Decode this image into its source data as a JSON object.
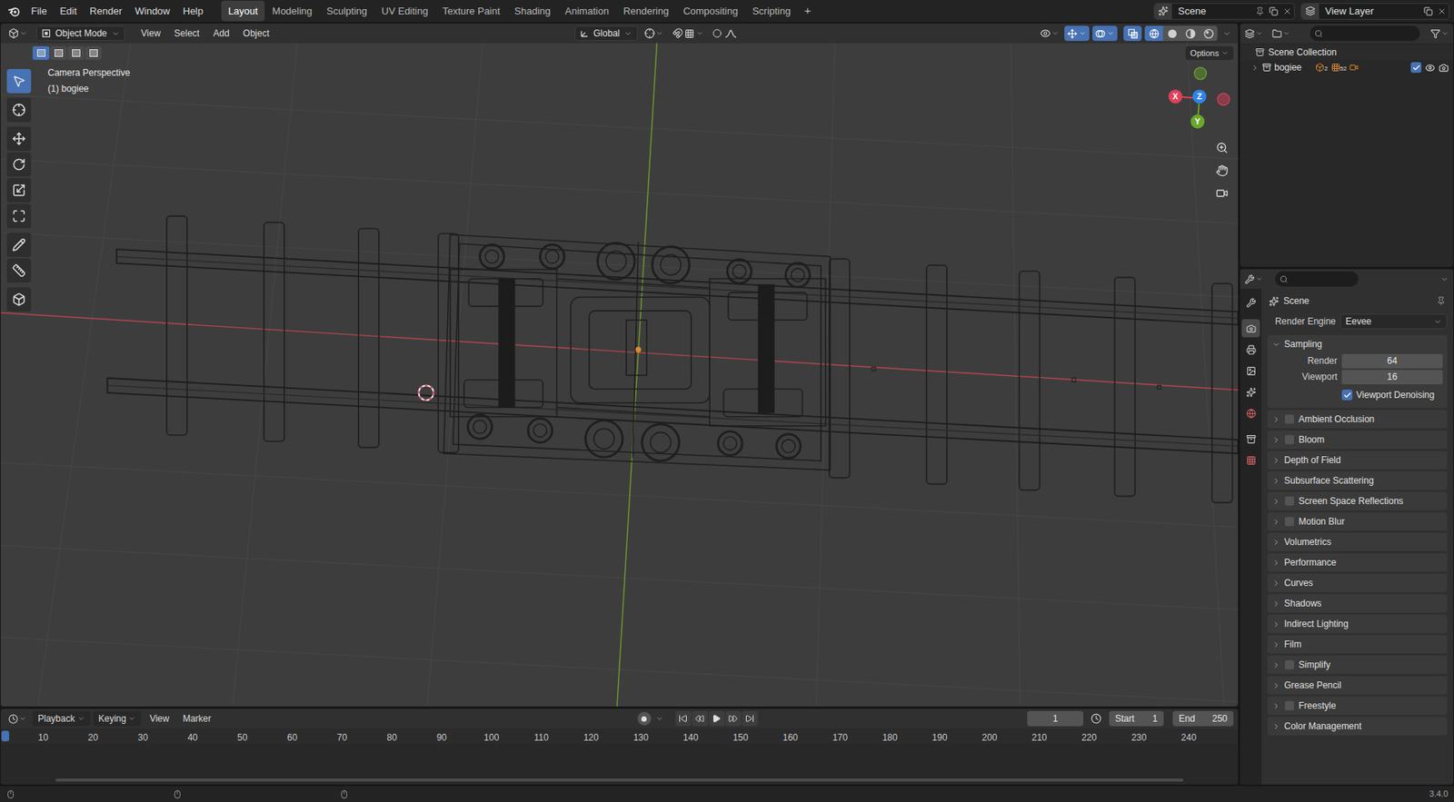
{
  "top_bar": {
    "menu": [
      "File",
      "Edit",
      "Render",
      "Window",
      "Help"
    ],
    "workspaces": [
      {
        "label": "Layout",
        "selected": true
      },
      {
        "label": "Modeling",
        "selected": false
      },
      {
        "label": "Sculpting",
        "selected": false
      },
      {
        "label": "UV Editing",
        "selected": false
      },
      {
        "label": "Texture Paint",
        "selected": false
      },
      {
        "label": "Shading",
        "selected": false
      },
      {
        "label": "Animation",
        "selected": false
      },
      {
        "label": "Rendering",
        "selected": false
      },
      {
        "label": "Compositing",
        "selected": false
      },
      {
        "label": "Scripting",
        "selected": false
      }
    ],
    "add_workspace": "+",
    "scene": "Scene",
    "view_layer": "View Layer"
  },
  "viewport": {
    "mode": "Object Mode",
    "menus": [
      "View",
      "Select",
      "Add",
      "Object"
    ],
    "orientation": "Global",
    "options": "Options",
    "view_name": "Camera Perspective",
    "object_label": "(1) bogiee",
    "select_modes": [
      {
        "selected": true
      },
      {
        "selected": false
      },
      {
        "selected": false
      },
      {
        "selected": false
      }
    ],
    "tools": [
      {
        "selected": true
      },
      {
        "selected": false
      },
      {
        "selected": false
      },
      {
        "selected": false
      },
      {
        "selected": false
      },
      {
        "selected": false
      },
      {
        "selected": false
      },
      {
        "selected": false
      },
      {
        "selected": false
      }
    ],
    "gizmos_on": true,
    "overlays_on": true,
    "xray": true,
    "shading_modes": [
      {
        "selected": true
      },
      {
        "selected": false
      },
      {
        "selected": false
      },
      {
        "selected": false
      }
    ],
    "axes": [
      {
        "label": "X",
        "color": "#e0415a"
      },
      {
        "label": "Y",
        "color": "#6aa82b"
      },
      {
        "label": "Z",
        "color": "#2f83e8"
      }
    ]
  },
  "outliner": {
    "root": "Scene Collection",
    "items": [
      {
        "name": "bogiee",
        "expanded": false,
        "counts": [
          "2",
          "52"
        ],
        "checked": true,
        "visible": true,
        "renderable": true
      }
    ]
  },
  "properties": {
    "tabs": [
      {
        "selected": false
      },
      {
        "selected": true
      },
      {
        "selected": false
      },
      {
        "selected": false
      },
      {
        "selected": false
      },
      {
        "selected": false
      },
      {
        "selected": false
      },
      {
        "selected": false
      }
    ],
    "context": "Scene",
    "render_engine": {
      "label": "Render Engine",
      "value": "Eevee"
    },
    "sampling": {
      "title": "Sampling",
      "expanded": true,
      "fields": [
        {
          "label": "Render",
          "value": "64"
        },
        {
          "label": "Viewport",
          "value": "16"
        }
      ],
      "denoising": {
        "label": "Viewport Denoising",
        "checked": true
      }
    },
    "panels": [
      {
        "title": "Ambient Occlusion",
        "kind": "toggle",
        "checked": false,
        "expanded": false
      },
      {
        "title": "Bloom",
        "kind": "toggle",
        "checked": false,
        "expanded": false
      },
      {
        "title": "Depth of Field",
        "kind": "plain",
        "expanded": false
      },
      {
        "title": "Subsurface Scattering",
        "kind": "plain",
        "expanded": false
      },
      {
        "title": "Screen Space Reflections",
        "kind": "toggle",
        "checked": false,
        "expanded": false
      },
      {
        "title": "Motion Blur",
        "kind": "toggle",
        "checked": false,
        "expanded": false
      },
      {
        "title": "Volumetrics",
        "kind": "plain",
        "expanded": false
      },
      {
        "title": "Performance",
        "kind": "plain",
        "expanded": false
      },
      {
        "title": "Curves",
        "kind": "plain",
        "expanded": false
      },
      {
        "title": "Shadows",
        "kind": "plain",
        "expanded": false
      },
      {
        "title": "Indirect Lighting",
        "kind": "plain",
        "expanded": false
      },
      {
        "title": "Film",
        "kind": "plain",
        "expanded": false
      },
      {
        "title": "Simplify",
        "kind": "toggle",
        "checked": false,
        "expanded": false
      },
      {
        "title": "Grease Pencil",
        "kind": "plain",
        "expanded": false
      },
      {
        "title": "Freestyle",
        "kind": "toggle",
        "checked": false,
        "expanded": false
      },
      {
        "title": "Color Management",
        "kind": "plain",
        "expanded": false
      }
    ]
  },
  "timeline": {
    "menus": [
      "Playback",
      "Keying",
      "View",
      "Marker"
    ],
    "dropdown_menus": [
      true,
      true,
      false,
      false
    ],
    "current_frame": "1",
    "start": {
      "label": "Start",
      "value": "1"
    },
    "end": {
      "label": "End",
      "value": "250"
    },
    "ticks": [
      "10",
      "20",
      "30",
      "40",
      "50",
      "60",
      "70",
      "80",
      "90",
      "100",
      "110",
      "120",
      "130",
      "140",
      "150",
      "160",
      "170",
      "180",
      "190",
      "200",
      "210",
      "220",
      "230",
      "240"
    ]
  },
  "status_bar": {
    "version": "3.4.0"
  }
}
